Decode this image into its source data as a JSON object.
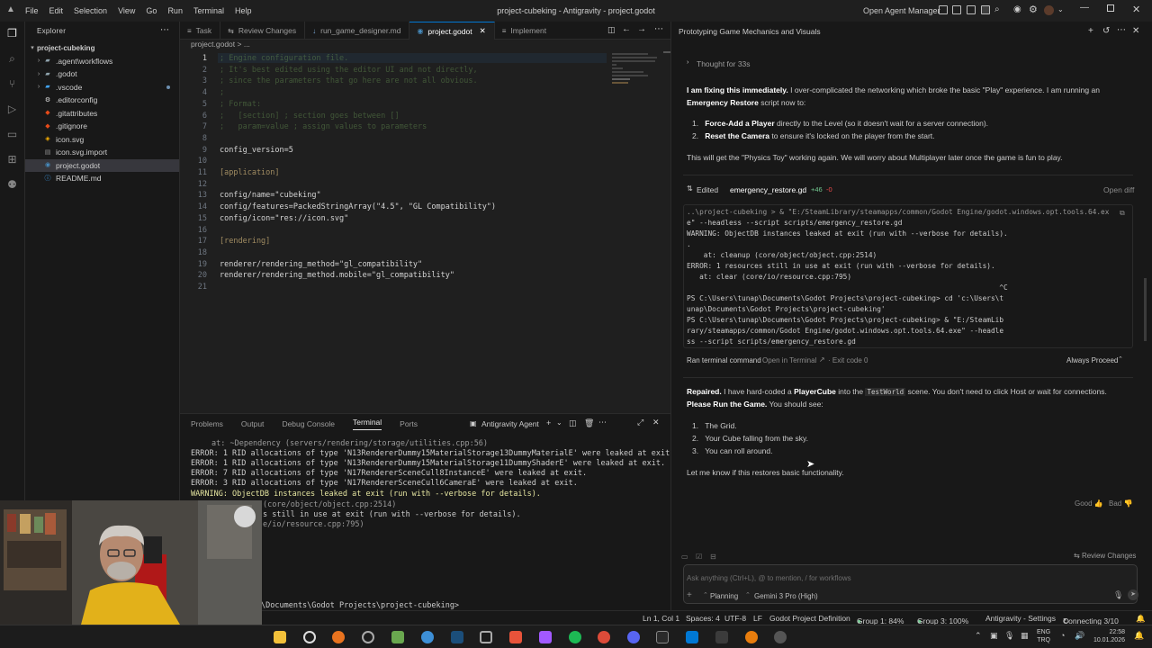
{
  "titlebar": {
    "menu": [
      "File",
      "Edit",
      "Selection",
      "View",
      "Go",
      "Run",
      "Terminal",
      "Help"
    ],
    "title": "project-cubeking - Antigravity - project.godot",
    "open_agent_manager": "Open Agent Manager"
  },
  "sidebar": {
    "header": "Explorer",
    "project": "project-cubeking",
    "items": [
      {
        "label": ".agent\\workflows",
        "type": "folder"
      },
      {
        "label": ".godot",
        "type": "folder"
      },
      {
        "label": ".vscode",
        "type": "folder"
      },
      {
        "label": ".editorconfig",
        "type": "file"
      },
      {
        "label": ".gitattributes",
        "type": "file"
      },
      {
        "label": ".gitignore",
        "type": "file"
      },
      {
        "label": "icon.svg",
        "type": "file"
      },
      {
        "label": "icon.svg.import",
        "type": "file"
      },
      {
        "label": "project.godot",
        "type": "file"
      },
      {
        "label": "README.md",
        "type": "file"
      }
    ]
  },
  "tabs": [
    "Task",
    "Review Changes",
    "run_game_designer.md",
    "project.godot",
    "Implement"
  ],
  "breadcrumb": "project.godot > ...",
  "editor": {
    "lines": [
      "; Engine configuration file.",
      "; It's best edited using the editor UI and not directly,",
      "; since the parameters that go here are not all obvious.",
      ";",
      "; Format:",
      ";   [section] ; section goes between []",
      ";   param=value ; assign values to parameters",
      "",
      "config_version=5",
      "",
      "[application]",
      "",
      "config/name=\"cubeking\"",
      "config/features=PackedStringArray(\"4.5\", \"GL Compatibility\")",
      "config/icon=\"res://icon.svg\"",
      "",
      "[rendering]",
      "",
      "renderer/rendering_method=\"gl_compatibility\"",
      "renderer/rendering_method.mobile=\"gl_compatibility\"",
      ""
    ]
  },
  "panel": {
    "tabs": [
      "Problems",
      "Output",
      "Debug Console",
      "Terminal",
      "Ports"
    ],
    "agent_label": "Antigravity Agent",
    "lines": [
      "at: ~Dependency (servers/rendering/storage/utilities.cpp:56)",
      "ERROR: 1 RID allocations of type 'N13RendererDummy15MaterialStorage13DummyMaterialE' were leaked at exit.",
      "ERROR: 1 RID allocations of type 'N13RendererDummy15MaterialStorage11DummyShaderE' were leaked at exit.",
      "ERROR: 7 RID allocations of type 'N17RendererSceneCull8InstanceE' were leaked at exit.",
      "ERROR: 3 RID allocations of type 'N17RendererSceneCull6CameraE' were leaked at exit.",
      "WARNING: ObjectDB instances leaked at exit (run with --verbose for details).",
      "(core/object/object.cpp:2514)",
      "s still in use at exit (run with --verbose for details).",
      "e/io/resource.cpp:795)"
    ],
    "prompt": "\\Documents\\Godot Projects\\project-cubeking>"
  },
  "agent": {
    "header": "Prototyping Game Mechanics and Visuals",
    "thought": "Thought for 33s",
    "p1_bold": "I am fixing this immediately.",
    "p1_rest": " I over-complicated the networking which broke the basic \"Play\" experience. I am running an",
    "p1_bold2": "Emergency Restore",
    "p1_rest2": " script now to:",
    "list1": [
      {
        "bold": "Force-Add a Player",
        "rest": " directly to the Level (so it doesn't wait for a server connection)."
      },
      {
        "bold": "Reset the Camera",
        "rest": " to ensure it's locked on the player from the start."
      }
    ],
    "p2": "This will get the \"Physics Toy\" working again. We will worry about Multiplayer later once the game is fun to play.",
    "edited_label": "Edited",
    "edited_file": "emergency_restore.gd",
    "edited_add": "+46",
    "edited_del": "-0",
    "open_diff": "Open diff",
    "term_lines": [
      "..\\project-cubeking > & \"E:/SteamLibrary/steamapps/common/Godot Engine/godot.windows.opt.tools.64.ex",
      "e\" --headless --script scripts/emergency_restore.gd",
      "WARNING: ObjectDB instances leaked at exit (run with --verbose for details).",
      ".",
      "    at: cleanup (core/object/object.cpp:2514)",
      "ERROR: 1 resources still in use at exit (run with --verbose for details).",
      "   at: clear (core/io/resource.cpp:795)",
      "                                                                          ^C",
      "PS C:\\Users\\tunap\\Documents\\Godot Projects\\project-cubeking> cd 'c:\\Users\\t",
      "unap\\Documents\\Godot Projects\\project-cubeking'",
      "PS C:\\Users\\tunap\\Documents\\Godot Projects\\project-cubeking> & \"E:/SteamLib",
      "rary/steamapps/common/Godot Engine/godot.windows.opt.tools.64.exe\" --headle",
      "ss --script scripts/emergency_restore.gd"
    ],
    "ran_cmd": "Ran terminal command",
    "open_in_terminal": "Open in Terminal",
    "exit_code": "Exit code 0",
    "always_proceed": "Always Proceed",
    "p3_bold": "Repaired.",
    "p3_a": " I have hard-coded a ",
    "p3_bold2": "PlayerCube",
    "p3_b": " into the ",
    "p3_code": "TestWorld",
    "p3_c": " scene. You don't need to click Host or wait for connections.",
    "p3_bold3": "Please Run the Game.",
    "p3_d": " You should see:",
    "list2": [
      "The Grid.",
      "Your Cube falling from the sky.",
      "You can roll around."
    ],
    "p4": "Let me know if this restores basic functionality.",
    "good": "Good",
    "bad": "Bad",
    "review_changes": "Review Changes",
    "input_placeholder": "Ask anything (Ctrl+L), @ to mention, / for workflows",
    "mode": "Planning",
    "model": "Gemini 3 Pro (High)"
  },
  "status": {
    "position": "Ln 1, Col 1",
    "spaces": "Spaces: 4",
    "encoding": "UTF-8",
    "eol": "LF",
    "language": "Godot Project Definition",
    "group1": "Group 1: 84%",
    "group3": "Group 3: 100%",
    "settings": "Antigravity - Settings",
    "connecting": "Connecting 3/10"
  },
  "taskbar": {
    "lang": "ENG",
    "region": "TRQ",
    "time": "22:58",
    "date": "10.01.2026"
  }
}
